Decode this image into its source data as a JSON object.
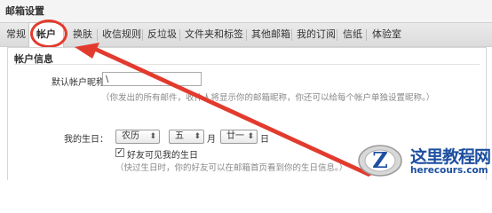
{
  "page": {
    "title": "邮箱设置"
  },
  "tabs": [
    {
      "label": "常规"
    },
    {
      "label": "帐户",
      "active": true
    },
    {
      "label": "换肤"
    },
    {
      "label": "收信规则"
    },
    {
      "label": "反垃圾"
    },
    {
      "label": "文件夹和标签"
    },
    {
      "label": "其他邮箱"
    },
    {
      "label": "我的订阅"
    },
    {
      "label": "信纸"
    },
    {
      "label": "体验室"
    }
  ],
  "account_info": {
    "section_title": "帐户信息",
    "nickname_label": "默认帐户昵称：",
    "nickname_value": "\\",
    "nickname_hint": "（你发出的所有邮件，收件人将显示你的邮箱昵称，你还可以给每个帐户单独设置昵称。）",
    "birthday_label": "我的生日：",
    "calendar_select": "农历",
    "month_select": "五",
    "month_unit": "月",
    "day_select": "廿一",
    "day_unit": "日",
    "friends_visible_label": "好友可见我的生日",
    "friends_visible_checked": true,
    "birthday_hint": "（快过生日时，你的好友可以在邮箱首页看到你的生日信息。）"
  },
  "watermark": {
    "title": "这里教程网",
    "url": "herecours.com"
  },
  "colors": {
    "annotation": "#e23b2e",
    "tab_bar": "#e2e2e2",
    "brand": "#1d4fa0"
  }
}
